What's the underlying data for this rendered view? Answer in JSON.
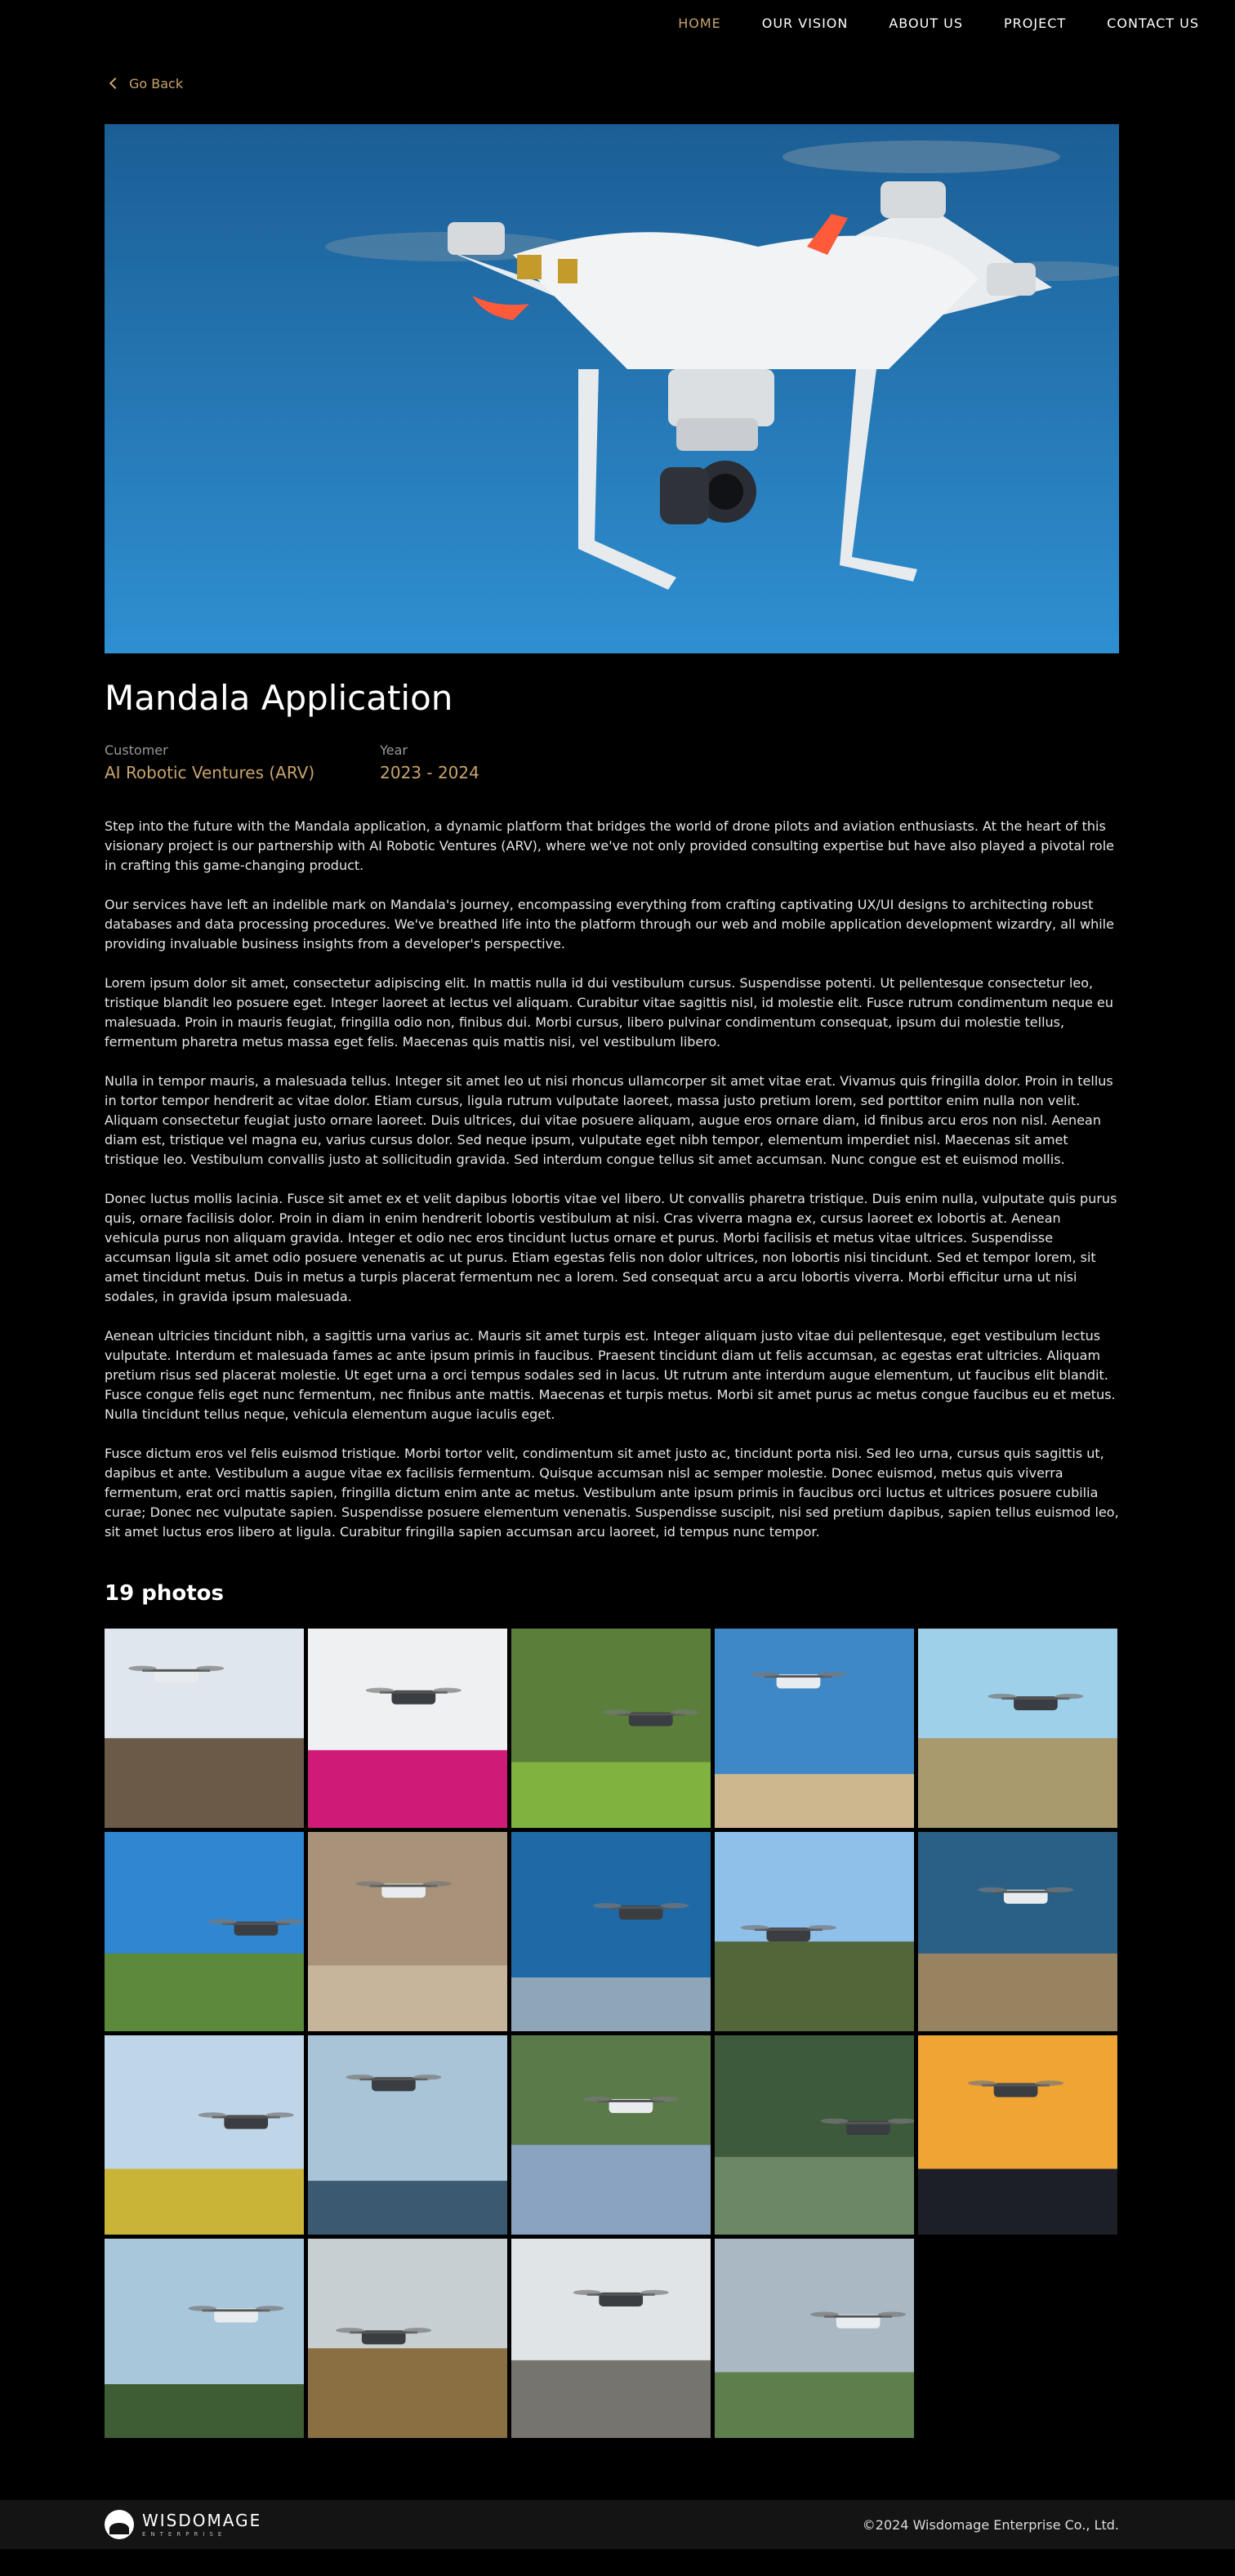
{
  "nav": {
    "items": [
      {
        "label": "HOME",
        "active": true
      },
      {
        "label": "OUR VISION",
        "active": false
      },
      {
        "label": "ABOUT US",
        "active": false
      },
      {
        "label": "PROJECT",
        "active": false
      },
      {
        "label": "CONTACT US",
        "active": false
      }
    ]
  },
  "back_label": "Go Back",
  "project": {
    "title": "Mandala Application",
    "customer_label": "Customer",
    "customer_value": "AI Robotic Ventures (ARV)",
    "year_label": "Year",
    "year_value": "2023 - 2024"
  },
  "paragraphs": [
    "Step into the future with the Mandala application, a dynamic platform that bridges the world of drone pilots and aviation enthusiasts. At the heart of this visionary project is our partnership with AI Robotic Ventures (ARV), where we've not only provided consulting expertise but have also played a pivotal role in crafting this game-changing product.",
    "Our services have left an indelible mark on Mandala's journey, encompassing everything from crafting captivating UX/UI designs to architecting robust databases and data processing procedures. We've breathed life into the platform through our web and mobile application development wizardry, all while providing invaluable business insights from a developer's perspective.",
    "Lorem ipsum dolor sit amet, consectetur adipiscing elit. In mattis nulla id dui vestibulum cursus. Suspendisse potenti. Ut pellentesque consectetur leo, tristique blandit leo posuere eget. Integer laoreet at lectus vel aliquam. Curabitur vitae sagittis nisl, id molestie elit. Fusce rutrum condimentum neque eu malesuada. Proin in mauris feugiat, fringilla odio non, finibus dui. Morbi cursus, libero pulvinar condimentum consequat, ipsum dui molestie tellus, fermentum pharetra metus massa eget felis. Maecenas quis mattis nisi, vel vestibulum libero.",
    "Nulla in tempor mauris, a malesuada tellus. Integer sit amet leo ut nisi rhoncus ullamcorper sit amet vitae erat. Vivamus quis fringilla dolor. Proin in tellus in tortor tempor hendrerit ac vitae dolor. Etiam cursus, ligula rutrum vulputate laoreet, massa justo pretium lorem, sed porttitor enim nulla non velit. Aliquam consectetur feugiat justo ornare laoreet. Duis ultrices, dui vitae posuere aliquam, augue eros ornare diam, id finibus arcu eros non nisl. Aenean diam est, tristique vel magna eu, varius cursus dolor. Sed neque ipsum, vulputate eget nibh tempor, elementum imperdiet nisl. Maecenas sit amet tristique leo. Vestibulum convallis justo at sollicitudin gravida. Sed interdum congue tellus sit amet accumsan. Nunc congue est et euismod mollis.",
    "Donec luctus mollis lacinia. Fusce sit amet ex et velit dapibus lobortis vitae vel libero. Ut convallis pharetra tristique. Duis enim nulla, vulputate quis purus quis, ornare facilisis dolor. Proin in diam in enim hendrerit lobortis vestibulum at nisi. Cras viverra magna ex, cursus laoreet ex lobortis at. Aenean vehicula purus non aliquam gravida. Integer et odio nec eros tincidunt luctus ornare et purus. Morbi facilisis et metus vitae ultrices. Suspendisse accumsan ligula sit amet odio posuere venenatis ac ut purus. Etiam egestas felis non dolor ultrices, non lobortis nisi tincidunt. Sed et tempor lorem, sit amet tincidunt metus. Duis in metus a turpis placerat fermentum nec a lorem. Sed consequat arcu a arcu lobortis viverra. Morbi efficitur urna ut nisi sodales, in gravida ipsum malesuada.",
    "Aenean ultricies tincidunt nibh, a sagittis urna varius ac. Mauris sit amet turpis est. Integer aliquam justo vitae dui pellentesque, eget vestibulum lectus vulputate. Interdum et malesuada fames ac ante ipsum primis in faucibus. Praesent tincidunt diam ut felis accumsan, ac egestas erat ultricies. Aliquam pretium risus sed placerat molestie. Ut eget urna a orci tempus sodales sed in lacus. Ut rutrum ante interdum augue elementum, ut faucibus elit blandit. Fusce congue felis eget nunc fermentum, nec finibus ante mattis. Maecenas et turpis metus. Morbi sit amet purus ac metus congue faucibus eu et metus. Nulla tincidunt tellus neque, vehicula elementum augue iaculis eget.",
    "Fusce dictum eros vel felis euismod tristique. Morbi tortor velit, condimentum sit amet justo ac, tincidunt porta nisi. Sed leo urna, cursus quis sagittis ut, dapibus et ante. Vestibulum a augue vitae ex facilisis fermentum. Quisque accumsan nisl ac semper molestie. Donec euismod, metus quis viverra fermentum, erat orci mattis sapien, fringilla dictum enim ante ac metus. Vestibulum ante ipsum primis in faucibus orci luctus et ultrices posuere cubilia curae; Donec nec vulputate sapien. Suspendisse posuere elementum venenatis. Suspendisse suscipit, nisi sed pretium dapibus, sapien tellus euismod leo, sit amet luctus eros libero at ligula. Curabitur fringilla sapien accumsan arcu laoreet, id tempus nunc tempor."
  ],
  "photos_title": "19 photos",
  "photos": [
    {
      "sky": "#dfe6ee",
      "ground": "#6b5a48"
    },
    {
      "sky": "#eef0f2",
      "ground": "#d01a78"
    },
    {
      "sky": "#5b7f3a",
      "ground": "#7fb23e"
    },
    {
      "sky": "#3f88c8",
      "ground": "#cdb78f"
    },
    {
      "sky": "#9fd0ea",
      "ground": "#a99a6d"
    },
    {
      "sky": "#2f86d1",
      "ground": "#5c8a3a"
    },
    {
      "sky": "#a8937a",
      "ground": "#c7b59b"
    },
    {
      "sky": "#1f6aa6",
      "ground": "#8fa6b8"
    },
    {
      "sky": "#8fc0ea",
      "ground": "#52663a"
    },
    {
      "sky": "#2a5f86",
      "ground": "#97835f"
    },
    {
      "sky": "#bfd5e8",
      "ground": "#c9b437"
    },
    {
      "sky": "#a9c4d6",
      "ground": "#3b5a72"
    },
    {
      "sky": "#5b7a4a",
      "ground": "#8aa3c1"
    },
    {
      "sky": "#3d5a3c",
      "ground": "#6c8765"
    },
    {
      "sky": "#f0a434",
      "ground": "#1d1f26"
    },
    {
      "sky": "#a9c7db",
      "ground": "#3e5d34"
    },
    {
      "sky": "#c8cfd3",
      "ground": "#8a6f42"
    },
    {
      "sky": "#e1e4e6",
      "ground": "#76746f"
    },
    {
      "sky": "#a9b8c3",
      "ground": "#5e7f4b"
    }
  ],
  "footer": {
    "brand_name": "WISDOMAGE",
    "brand_sub": "ENTERPRISE",
    "copyright": "©2024 Wisdomage Enterprise Co., Ltd."
  },
  "colors": {
    "accent": "#c9a46c",
    "background": "#000000",
    "footer_bg": "#141414"
  }
}
